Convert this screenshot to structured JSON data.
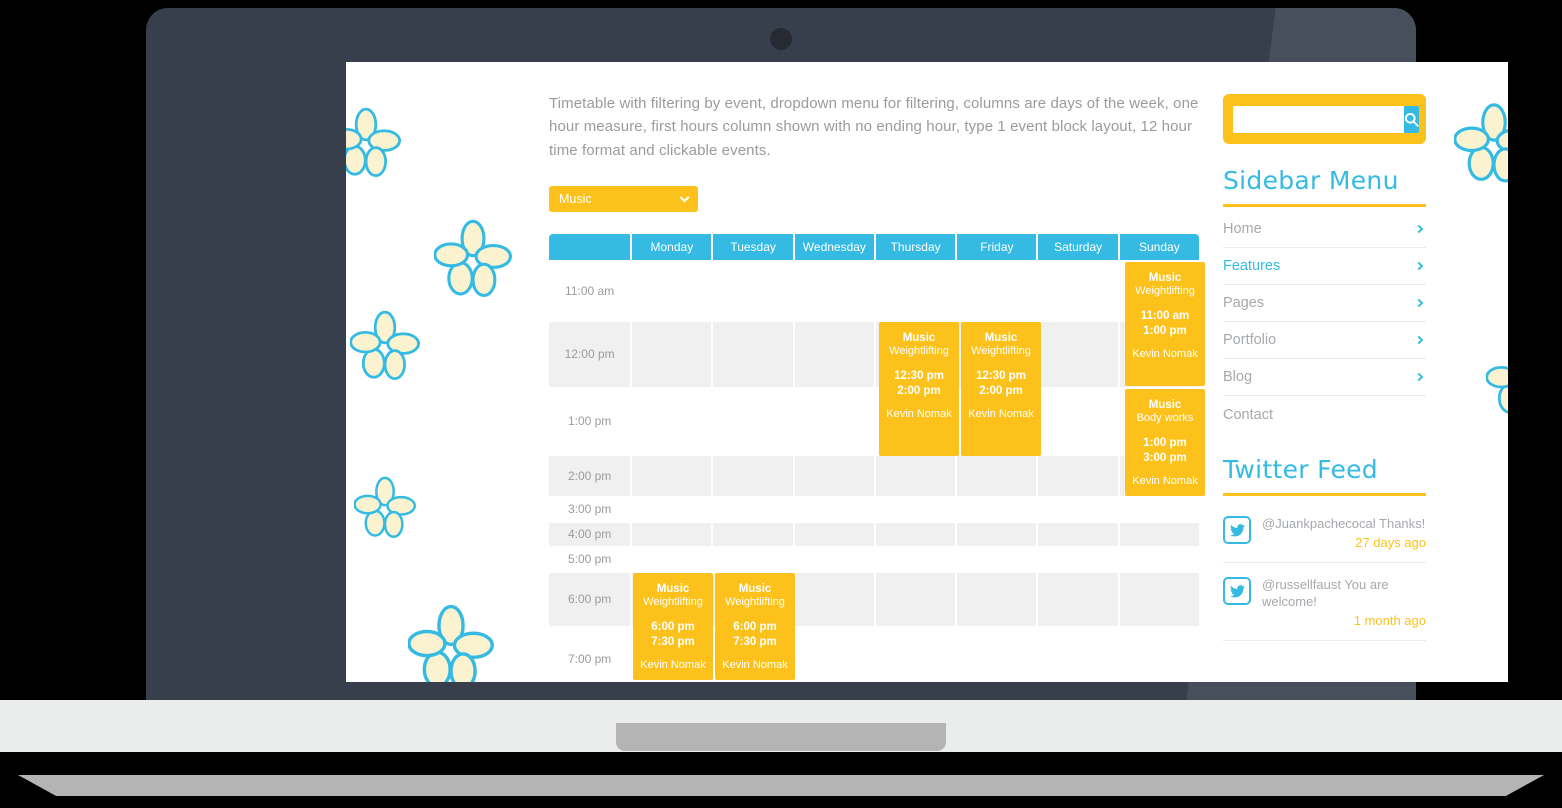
{
  "device": {
    "type": "laptop-mockup"
  },
  "main": {
    "intro": "Timetable with filtering by event, dropdown menu for filtering, columns are days of the week, one hour measure, first hours column shown with no ending hour, type 1 event block layout, 12 hour time format and clickable events.",
    "filter": {
      "selected": "Music",
      "icon": "chevron-down-icon"
    }
  },
  "timetable": {
    "columns": [
      "",
      "Monday",
      "Tuesday",
      "Wednesday",
      "Thursday",
      "Friday",
      "Saturday",
      "Sunday"
    ],
    "times": [
      "11:00 am",
      "12:00 pm",
      "1:00 pm",
      "2:00 pm",
      "3:00 pm",
      "4:00 pm",
      "5:00 pm",
      "6:00 pm",
      "7:00 pm"
    ],
    "events": [
      {
        "day": "Sunday",
        "category": "Music",
        "name": "Weightlifting",
        "start": "11:00 am",
        "end": "1:00 pm",
        "instructor": "Kevin Nomak"
      },
      {
        "day": "Thursday",
        "category": "Music",
        "name": "Weightlifting",
        "start": "12:30 pm",
        "end": "2:00 pm",
        "instructor": "Kevin Nomak"
      },
      {
        "day": "Friday",
        "category": "Music",
        "name": "Weightlifting",
        "start": "12:30 pm",
        "end": "2:00 pm",
        "instructor": "Kevin Nomak"
      },
      {
        "day": "Sunday",
        "category": "Music",
        "name": "Body works",
        "start": "1:00 pm",
        "end": "3:00 pm",
        "instructor": "Kevin Nomak"
      },
      {
        "day": "Monday",
        "category": "Music",
        "name": "Weightlifting",
        "start": "6:00 pm",
        "end": "7:30 pm",
        "instructor": "Kevin Nomak"
      },
      {
        "day": "Tuesday",
        "category": "Music",
        "name": "Weightlifting",
        "start": "6:00 pm",
        "end": "7:30 pm",
        "instructor": "Kevin Nomak"
      }
    ]
  },
  "sidebar": {
    "search": {
      "value": "",
      "placeholder": "",
      "icon": "search-icon"
    },
    "menu": {
      "title": "Sidebar Menu",
      "items": [
        {
          "label": "Home",
          "has_chevron": true,
          "active": false
        },
        {
          "label": "Features",
          "has_chevron": true,
          "active": true
        },
        {
          "label": "Pages",
          "has_chevron": true,
          "active": false
        },
        {
          "label": "Portfolio",
          "has_chevron": true,
          "active": false
        },
        {
          "label": "Blog",
          "has_chevron": true,
          "active": false
        },
        {
          "label": "Contact",
          "has_chevron": false,
          "active": false
        }
      ]
    },
    "twitter": {
      "title": "Twitter Feed",
      "tweets": [
        {
          "text": "@Juankpachecocal Thanks!",
          "time": "27 days ago"
        },
        {
          "text": "@russellfaust You are welcome!",
          "time": "1 month ago"
        }
      ]
    }
  },
  "colors": {
    "accent_yellow": "#FCC21B",
    "accent_blue": "#35BBE3",
    "frame_dark": "#373e4c",
    "row_alt": "#F0F0F0",
    "muted_text": "#9b9b9b"
  }
}
